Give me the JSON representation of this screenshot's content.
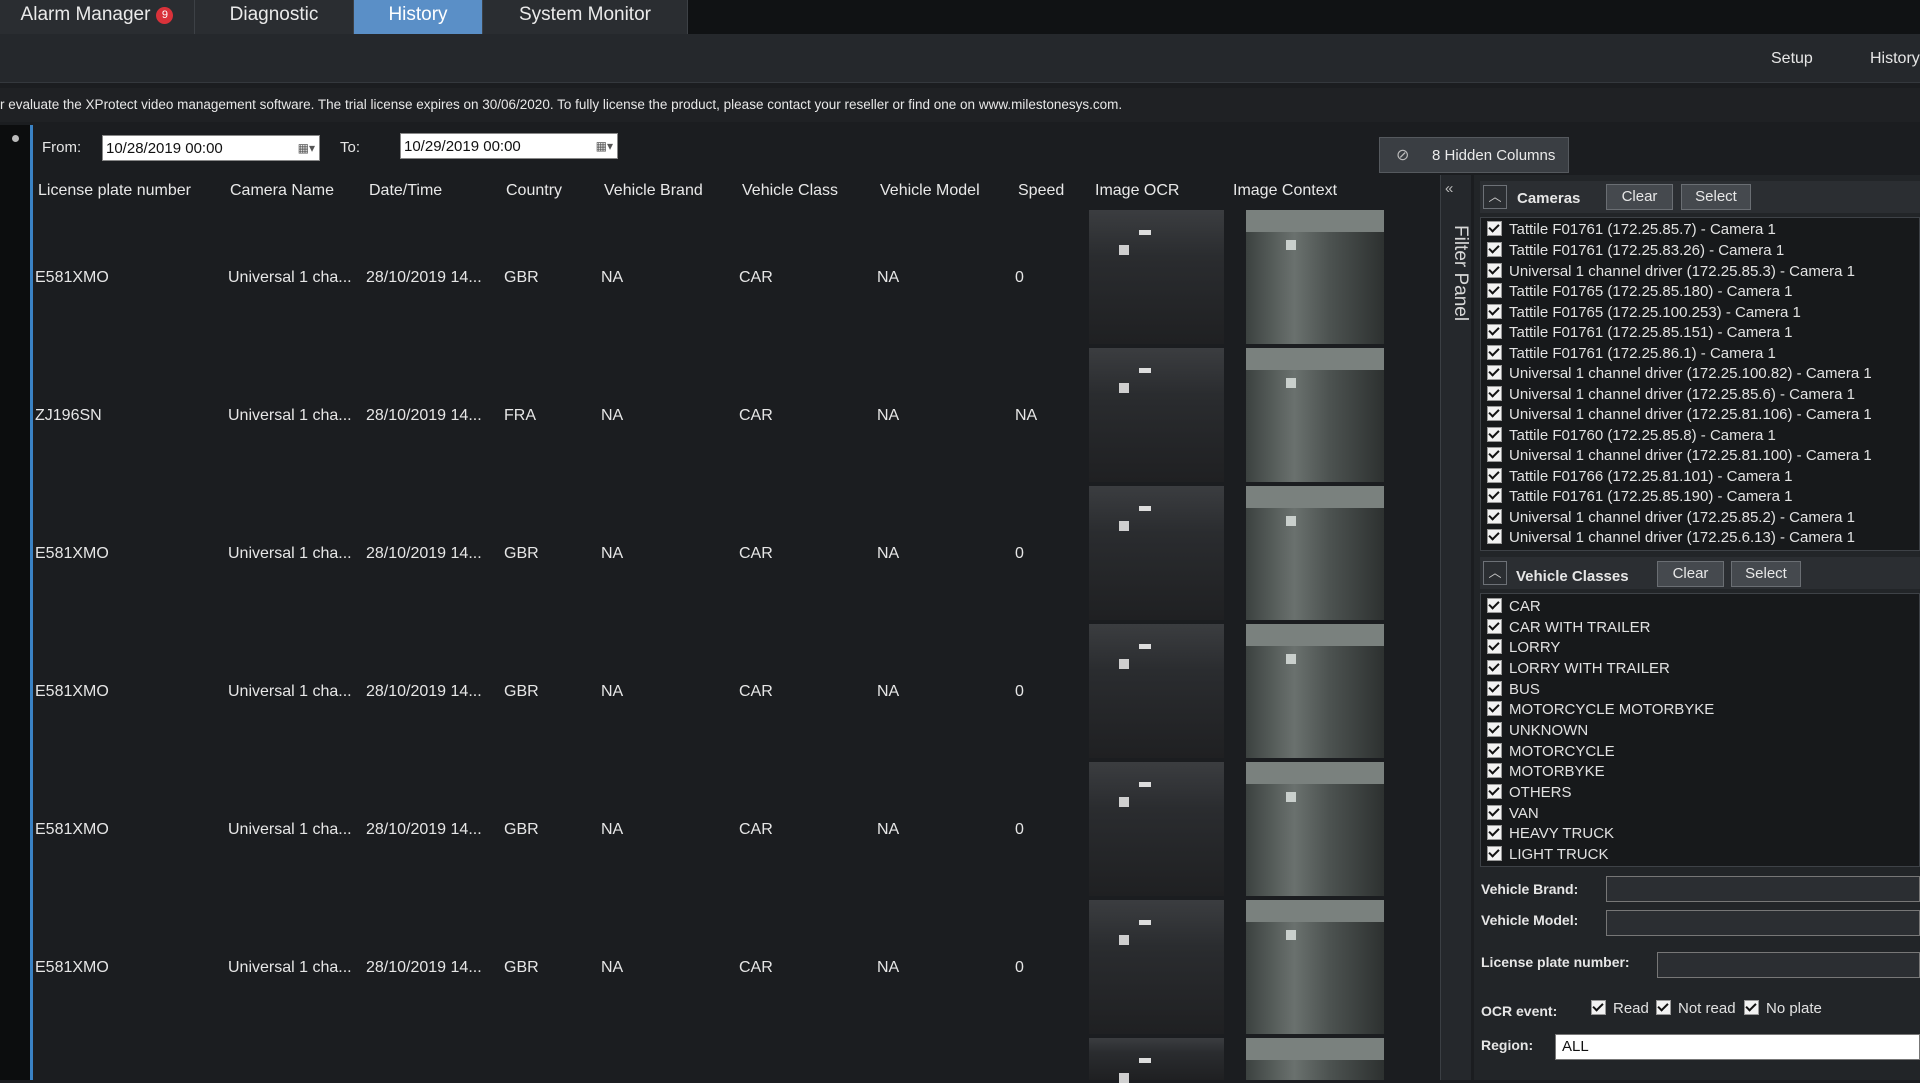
{
  "tabs": [
    {
      "label": "Alarm Manager",
      "badge": "9"
    },
    {
      "label": "Diagnostic"
    },
    {
      "label": "History",
      "active": true
    },
    {
      "label": "System Monitor"
    }
  ],
  "subbar": {
    "setup": "Setup",
    "history": "History"
  },
  "trial_notice": "r evaluate the XProtect video management software. The trial license expires on 30/06/2020. To fully license the product, please contact your reseller or find one on www.milestonesys.com.",
  "filters": {
    "from_label": "From:",
    "from_value": "10/28/2019 00:00",
    "to_label": "To:",
    "to_value": "10/29/2019 00:00",
    "hidden_columns": "8 Hidden Columns"
  },
  "table": {
    "headers": [
      "License plate number",
      "Camera Name",
      "Date/Time",
      "Country",
      "Vehicle Brand",
      "Vehicle Class",
      "Vehicle Model",
      "Speed",
      "Image OCR",
      "Image Context"
    ],
    "rows": [
      {
        "plate": "E581XMO",
        "camera": "Universal 1 cha...",
        "datetime": "28/10/2019 14...",
        "country": "GBR",
        "brand": "NA",
        "class": "CAR",
        "model": "NA",
        "speed": "0"
      },
      {
        "plate": "ZJ196SN",
        "camera": "Universal 1 cha...",
        "datetime": "28/10/2019 14...",
        "country": "FRA",
        "brand": "NA",
        "class": "CAR",
        "model": "NA",
        "speed": "NA"
      },
      {
        "plate": "E581XMO",
        "camera": "Universal 1 cha...",
        "datetime": "28/10/2019 14...",
        "country": "GBR",
        "brand": "NA",
        "class": "CAR",
        "model": "NA",
        "speed": "0"
      },
      {
        "plate": "E581XMO",
        "camera": "Universal 1 cha...",
        "datetime": "28/10/2019 14...",
        "country": "GBR",
        "brand": "NA",
        "class": "CAR",
        "model": "NA",
        "speed": "0"
      },
      {
        "plate": "E581XMO",
        "camera": "Universal 1 cha...",
        "datetime": "28/10/2019 14...",
        "country": "GBR",
        "brand": "NA",
        "class": "CAR",
        "model": "NA",
        "speed": "0"
      },
      {
        "plate": "E581XMO",
        "camera": "Universal 1 cha...",
        "datetime": "28/10/2019 14...",
        "country": "GBR",
        "brand": "NA",
        "class": "CAR",
        "model": "NA",
        "speed": "0"
      }
    ]
  },
  "filter_panel": {
    "label": "Filter Panel",
    "cameras": {
      "title": "Cameras",
      "clear": "Clear",
      "select": "Select",
      "items": [
        "Tattile F01761 (172.25.85.7) - Camera 1",
        "Tattile F01761 (172.25.83.26) - Camera 1",
        "Universal 1 channel driver (172.25.85.3) - Camera 1",
        "Tattile F01765 (172.25.85.180) - Camera 1",
        "Tattile F01765 (172.25.100.253) - Camera 1",
        "Tattile F01761 (172.25.85.151) - Camera 1",
        "Tattile F01761 (172.25.86.1) - Camera 1",
        "Universal 1 channel driver (172.25.100.82) - Camera 1",
        "Universal 1 channel driver (172.25.85.6) - Camera 1",
        "Universal 1 channel driver (172.25.81.106) - Camera 1",
        "Tattile F01760 (172.25.85.8) - Camera 1",
        "Universal 1 channel driver (172.25.81.100) - Camera 1",
        "Tattile F01766 (172.25.81.101) - Camera 1",
        "Tattile F01761 (172.25.85.190) - Camera 1",
        "Universal 1 channel driver (172.25.85.2) - Camera 1",
        "Universal 1 channel driver (172.25.6.13) - Camera 1"
      ]
    },
    "vehicle_classes": {
      "title": "Vehicle Classes",
      "clear": "Clear",
      "select": "Select",
      "items": [
        "CAR",
        "CAR WITH TRAILER",
        "LORRY",
        "LORRY WITH TRAILER",
        "BUS",
        "MOTORCYCLE MOTORBYKE",
        "UNKNOWN",
        "MOTORCYCLE",
        "MOTORBYKE",
        "OTHERS",
        "VAN",
        "HEAVY TRUCK",
        "LIGHT TRUCK"
      ]
    },
    "vehicle_brand_label": "Vehicle Brand:",
    "vehicle_model_label": "Vehicle Model:",
    "plate_label": "License plate number:",
    "ocr_event_label": "OCR event:",
    "ocr_options": [
      "Read",
      "Not read",
      "No plate"
    ],
    "region_label": "Region:",
    "region_value": "ALL"
  }
}
